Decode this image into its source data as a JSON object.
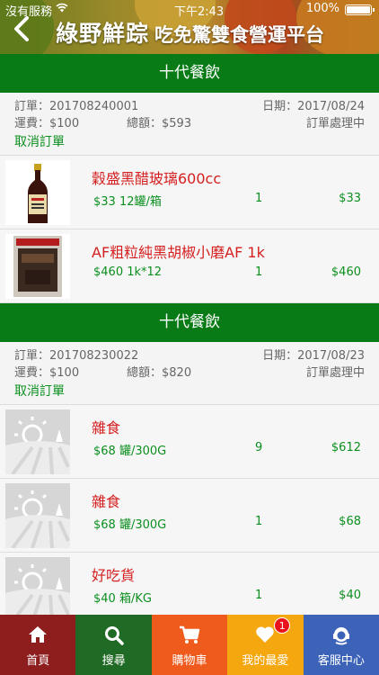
{
  "status_bar": {
    "carrier": "沒有服務",
    "time": "下午2:43",
    "battery": "100%"
  },
  "header": {
    "title_main": "綠野鮮踪",
    "title_sub": "吃免驚雙食營運平台"
  },
  "orders": [
    {
      "store": "十代餐飲",
      "order_no": "訂單：201708240001",
      "date": "日期：2017/08/24",
      "shipping": "運費：$100",
      "total": "總額：$593",
      "status": "訂單處理中",
      "cancel_label": "取消訂單",
      "items": [
        {
          "name": "穀盛黑醋玻璃600cc",
          "price": "$33 12罐/箱",
          "qty": "1",
          "subtotal": "$33",
          "thumb": "vinegar-bottle"
        },
        {
          "name": "AF粗粒純黑胡椒小磨AF 1k",
          "price": "$460 1k*12",
          "qty": "1",
          "subtotal": "$460",
          "thumb": "pepper-bag"
        }
      ]
    },
    {
      "store": "十代餐飲",
      "order_no": "訂單：201708230022",
      "date": "日期：2017/08/23",
      "shipping": "運費：$100",
      "total": "總額：$820",
      "status": "訂單處理中",
      "cancel_label": "取消訂單",
      "items": [
        {
          "name": "雜食",
          "price": "$68 罐/300G",
          "qty": "9",
          "subtotal": "$612",
          "thumb": "placeholder"
        },
        {
          "name": "雜食",
          "price": "$68 罐/300G",
          "qty": "1",
          "subtotal": "$68",
          "thumb": "placeholder"
        },
        {
          "name": "好吃貨",
          "price": "$40 箱/KG",
          "qty": "1",
          "subtotal": "$40",
          "thumb": "placeholder"
        }
      ]
    }
  ],
  "tabbar": [
    {
      "label": "首頁",
      "icon": "home-icon",
      "color": "#8e1d1d"
    },
    {
      "label": "搜尋",
      "icon": "search-icon",
      "color": "#1f6a24"
    },
    {
      "label": "購物車",
      "icon": "cart-icon",
      "color": "#ef5a1d"
    },
    {
      "label": "我的最愛",
      "icon": "heart-icon",
      "color": "#f5a70f",
      "badge": "1"
    },
    {
      "label": "客服中心",
      "icon": "support-icon",
      "color": "#3d63b8"
    }
  ]
}
